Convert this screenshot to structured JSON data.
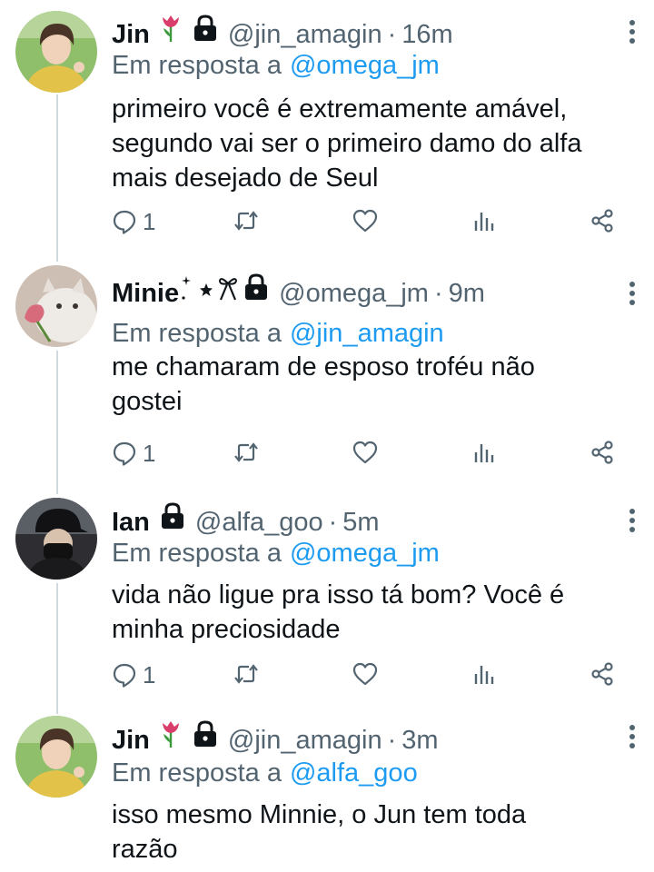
{
  "tweets": [
    {
      "name": "Jin",
      "handle": "@jin_amagin",
      "time": "16m",
      "reply_prefix": "Em resposta a",
      "reply_to": "@omega_jm",
      "lines": [
        "primeiro você é extremamente amável,",
        "segundo vai ser o primeiro damo do alfa",
        "mais desejado de Seul"
      ],
      "replies": "1"
    },
    {
      "name": "Minie",
      "handle": "@omega_jm",
      "time": "9m",
      "reply_prefix": "Em resposta a",
      "reply_to": "@jin_amagin",
      "lines": [
        "me chamaram de esposo troféu não",
        "gostei"
      ],
      "replies": "1"
    },
    {
      "name": "Ian",
      "handle": "@alfa_goo",
      "time": "5m",
      "reply_prefix": "Em resposta a",
      "reply_to": "@omega_jm",
      "lines": [
        "vida não ligue pra isso tá bom? Você é",
        "minha preciosidade"
      ],
      "replies": "1"
    },
    {
      "name": "Jin",
      "handle": "@jin_amagin",
      "time": "3m",
      "reply_prefix": "Em resposta a",
      "reply_to": "@alfa_goo",
      "lines": [
        "isso mesmo Minnie, o Jun tem toda",
        "razão"
      ]
    }
  ],
  "separator": "·",
  "colors": {
    "handle": "#536471",
    "mention": "#1d9bf0",
    "text": "#0f1419",
    "thread": "#cfd9de",
    "tulip": "#d93d6b"
  },
  "icons": [
    "tulip-icon",
    "lock-icon",
    "sparkle-icon",
    "star-icon",
    "ribbon-icon",
    "more-icon",
    "reply-icon",
    "retweet-icon",
    "like-icon",
    "views-icon",
    "share-icon"
  ]
}
